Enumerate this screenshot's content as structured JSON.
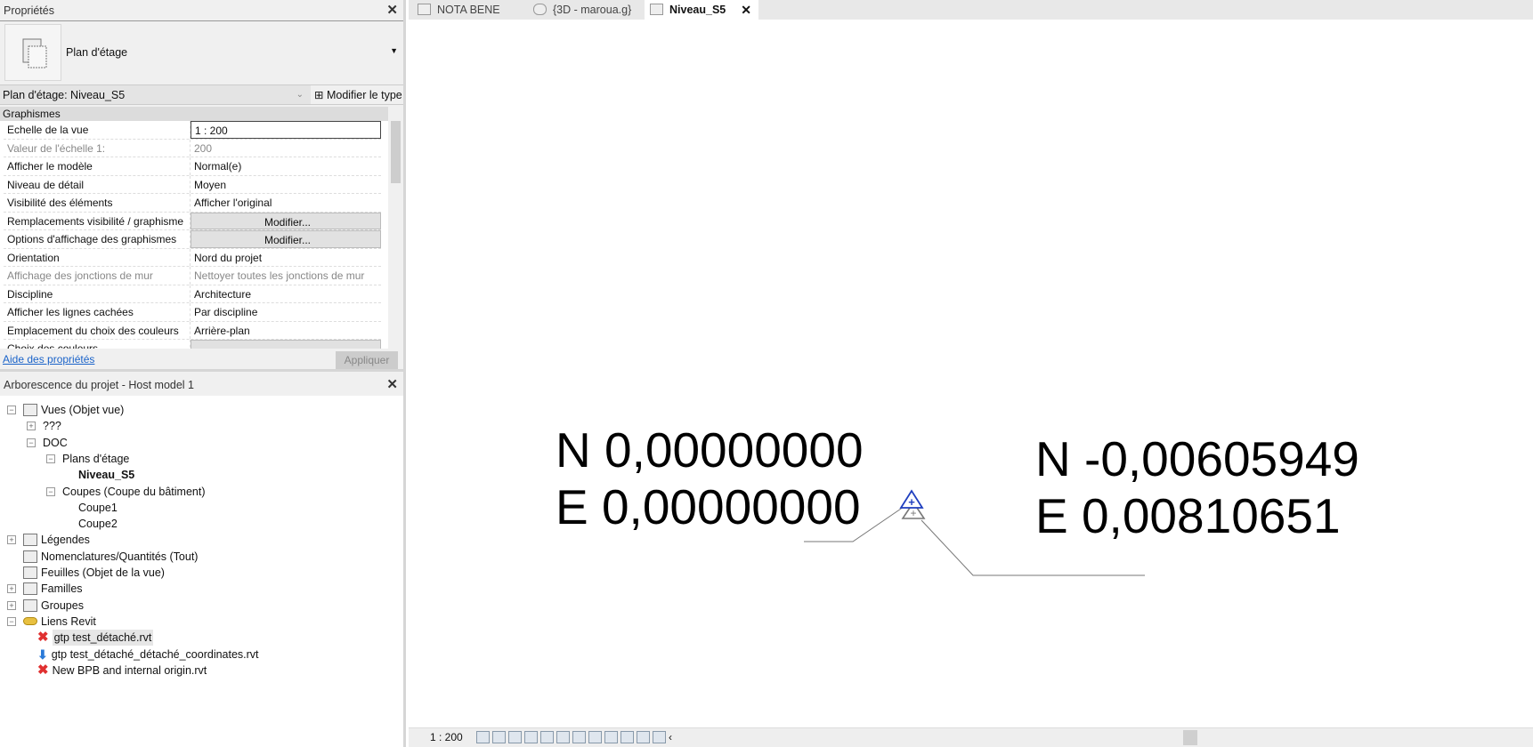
{
  "properties": {
    "title": "Propriétés",
    "type_name": "Plan d'étage",
    "instance_selector": "Plan d'étage: Niveau_S5",
    "edit_type": "Modifier le type",
    "group": "Graphismes",
    "rows": [
      {
        "key": "Echelle de la vue",
        "value": "1 : 200"
      },
      {
        "key": "Valeur de l'échelle    1:",
        "value": "200"
      },
      {
        "key": "Afficher le modèle",
        "value": "Normal(e)"
      },
      {
        "key": "Niveau de détail",
        "value": "Moyen"
      },
      {
        "key": "Visibilité des éléments",
        "value": "Afficher l'original"
      },
      {
        "key": "Remplacements visibilité / graphisme",
        "value": "Modifier..."
      },
      {
        "key": "Options d'affichage des graphismes",
        "value": "Modifier..."
      },
      {
        "key": "Orientation",
        "value": "Nord du projet"
      },
      {
        "key": "Affichage des jonctions de mur",
        "value": "Nettoyer toutes les jonctions de mur"
      },
      {
        "key": "Discipline",
        "value": "Architecture"
      },
      {
        "key": "Afficher les lignes cachées",
        "value": "Par discipline"
      },
      {
        "key": "Emplacement du choix des couleurs",
        "value": "Arrière-plan"
      },
      {
        "key": "Choix des couleurs",
        "value": "..."
      }
    ],
    "help_link": "Aide des propriétés",
    "apply": "Appliquer"
  },
  "browser": {
    "title": "Arborescence du projet - Host model 1",
    "items": [
      "Vues (Objet vue)",
      "???",
      "DOC",
      "Plans d'étage",
      "Niveau_S5",
      "Coupes (Coupe du bâtiment)",
      "Coupe1",
      "Coupe2",
      "Légendes",
      "Nomenclatures/Quantités (Tout)",
      "Feuilles (Objet de la vue)",
      "Familles",
      "Groupes",
      "Liens Revit",
      "gtp test_détaché.rvt",
      "gtp test_détaché_détaché_coordinates.rvt",
      "New BPB and internal origin.rvt"
    ]
  },
  "tabs": [
    "NOTA BENE",
    "{3D - maroua.g}",
    "Niveau_S5"
  ],
  "canvas": {
    "left_n": "N 0,00000000",
    "left_e": "E 0,00000000",
    "right_n": "N -0,00605949",
    "right_e": "E 0,00810651"
  },
  "status": {
    "scale": "1 : 200"
  },
  "colors": {
    "link": "#1a63c9",
    "survey_point": "#1f3fbf",
    "error": "#e03030",
    "accent_blue": "#2a7ad8"
  }
}
